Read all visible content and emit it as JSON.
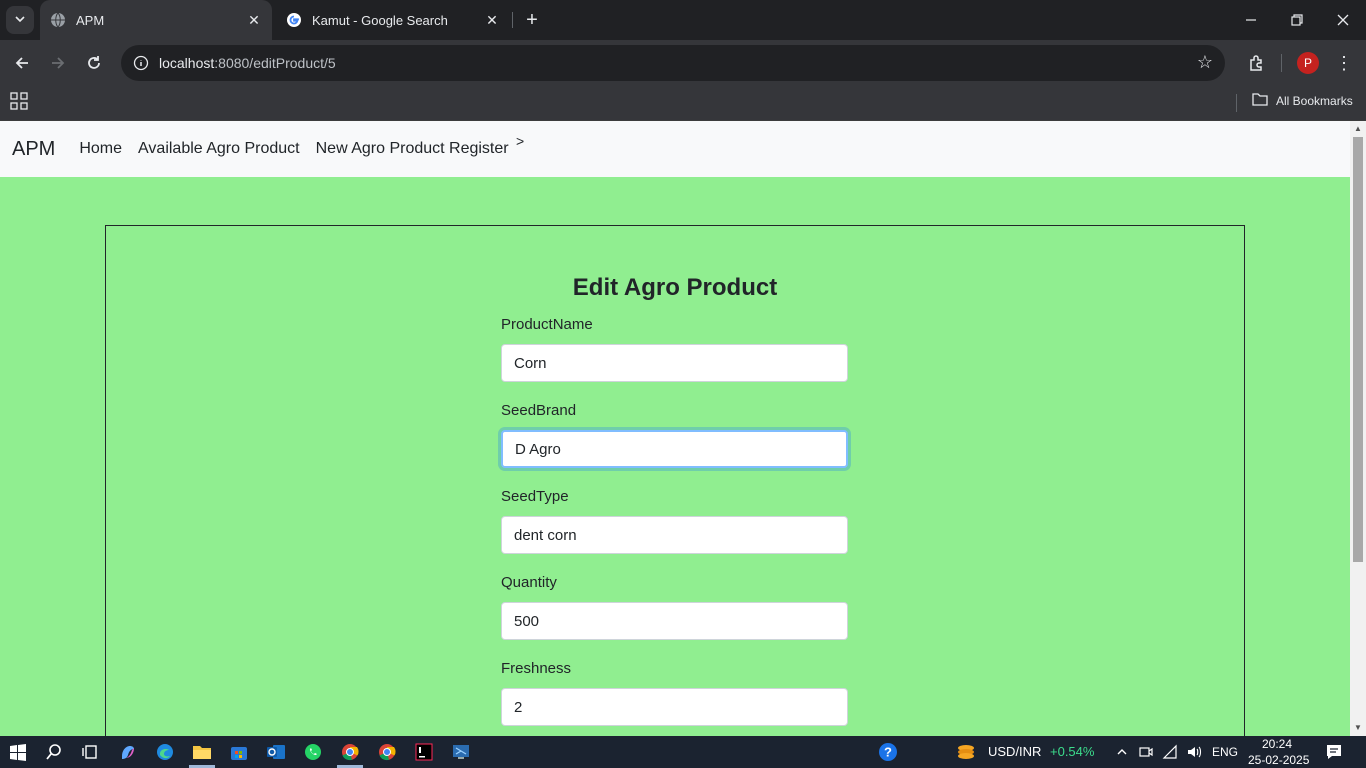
{
  "browser": {
    "tabs": [
      {
        "title": "APM",
        "active": true
      },
      {
        "title": "Kamut - Google Search",
        "active": false
      }
    ],
    "url_host": "localhost",
    "url_path": ":8080/editProduct/5",
    "bookmarks_label": "All Bookmarks",
    "profile_initial": "P"
  },
  "navbar": {
    "brand": "APM",
    "links": [
      "Home",
      "Available Agro Product",
      "New Agro Product Register"
    ],
    "chevron": ">"
  },
  "form": {
    "title": "Edit Agro Product",
    "fields": [
      {
        "label": "ProductName",
        "value": "Corn"
      },
      {
        "label": "SeedBrand",
        "value": "D Agro"
      },
      {
        "label": "SeedType",
        "value": "dent corn"
      },
      {
        "label": "Quantity",
        "value": "500"
      },
      {
        "label": "Freshness",
        "value": "2"
      }
    ]
  },
  "taskbar": {
    "ticker_label": "USD/INR",
    "ticker_change": "+0.54%",
    "language": "ENG",
    "time": "20:24",
    "date": "25-02-2025"
  },
  "colors": {
    "page_bg": "#90ee90",
    "navbar_bg": "#f8f9fa",
    "ticker_up": "#3cdc8c"
  }
}
